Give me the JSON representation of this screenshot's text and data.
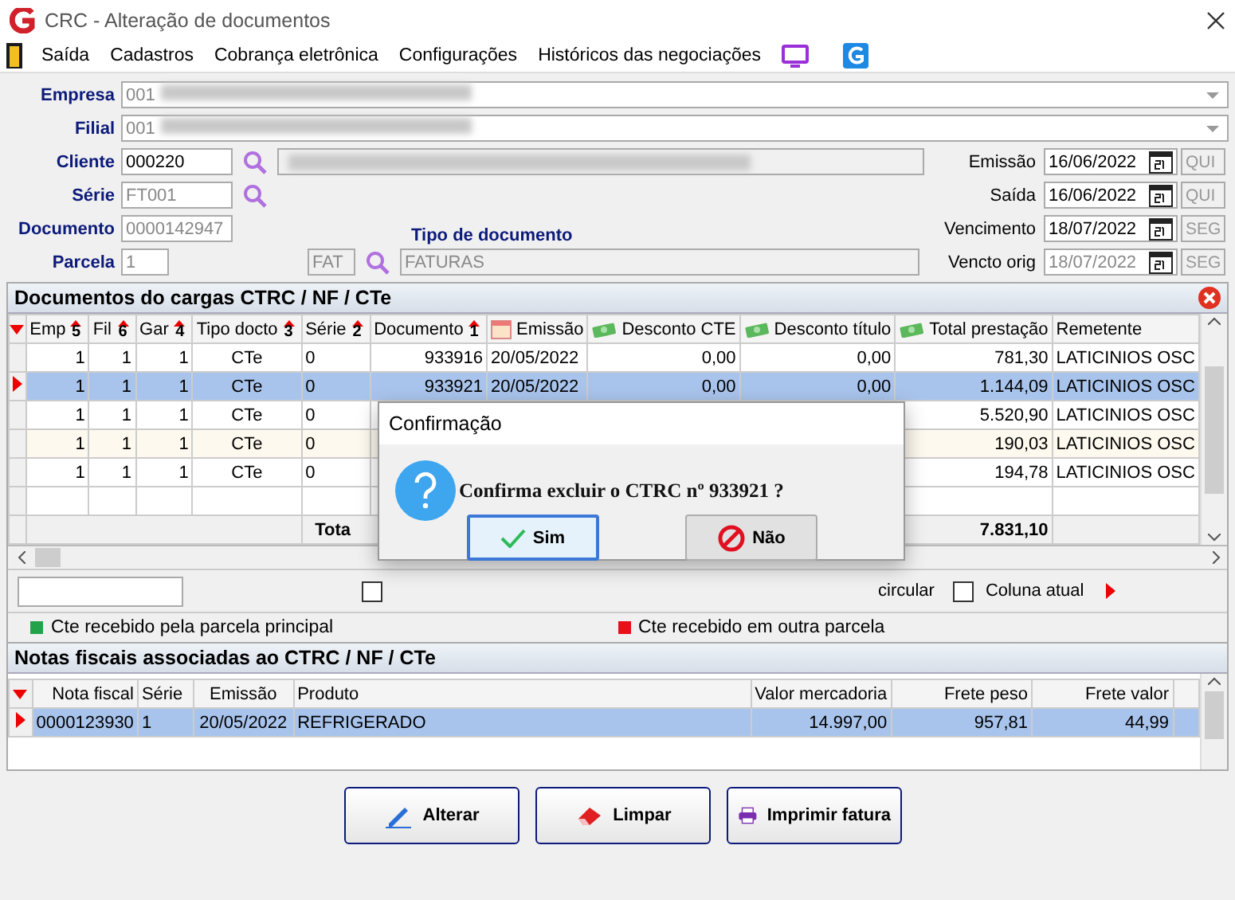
{
  "window": {
    "title": "CRC - Alteração de documentos"
  },
  "menu": [
    "Saída",
    "Cadastros",
    "Cobrança eletrônica",
    "Configurações",
    "Históricos das negociações"
  ],
  "form": {
    "empresa": {
      "label": "Empresa",
      "value": "001"
    },
    "filial": {
      "label": "Filial",
      "value": "001"
    },
    "cliente": {
      "label": "Cliente",
      "value": "000220"
    },
    "serie": {
      "label": "Série",
      "value": "FT001"
    },
    "documento": {
      "label": "Documento",
      "value": "0000142947"
    },
    "parcela": {
      "label": "Parcela",
      "value": "1"
    },
    "tipo_documento": {
      "label": "Tipo de documento",
      "code": "FAT",
      "name": "FATURAS"
    },
    "dates": [
      {
        "label": "Emissão",
        "value": "16/06/2022",
        "weekday": "QUI",
        "disabled": false
      },
      {
        "label": "Saída",
        "value": "16/06/2022",
        "weekday": "QUI",
        "disabled": false
      },
      {
        "label": "Vencimento",
        "value": "18/07/2022",
        "weekday": "SEG",
        "disabled": false
      },
      {
        "label": "Vencto orig",
        "value": "18/07/2022",
        "weekday": "SEG",
        "disabled": true
      }
    ]
  },
  "documents": {
    "title": "Documentos do cargas CTRC / NF / CTe",
    "columns": [
      {
        "label": "Emp",
        "sort": "5"
      },
      {
        "label": "Fil",
        "sort": "6"
      },
      {
        "label": "Gar",
        "sort": "4"
      },
      {
        "label": "Tipo docto",
        "sort": "3"
      },
      {
        "label": "Série",
        "sort": "2"
      },
      {
        "label": "Documento",
        "sort": "1"
      },
      {
        "label": "Emissão"
      },
      {
        "label": "Desconto CTE"
      },
      {
        "label": "Desconto título"
      },
      {
        "label": "Total prestação"
      },
      {
        "label": "Remetente"
      }
    ],
    "rows": [
      {
        "selected": false,
        "cells": [
          "1",
          "1",
          "1",
          "CTe",
          "0",
          "933916",
          "20/05/2022",
          "0,00",
          "0,00",
          "781,30",
          "LATICINIOS OSC"
        ]
      },
      {
        "selected": true,
        "cells": [
          "1",
          "1",
          "1",
          "CTe",
          "0",
          "933921",
          "20/05/2022",
          "0,00",
          "0,00",
          "1.144,09",
          "LATICINIOS OSC"
        ]
      },
      {
        "selected": false,
        "cells": [
          "1",
          "1",
          "1",
          "CTe",
          "0",
          null,
          null,
          null,
          null,
          "5.520,90",
          "LATICINIOS OSC"
        ]
      },
      {
        "selected": false,
        "cells": [
          "1",
          "1",
          "1",
          "CTe",
          "0",
          null,
          null,
          null,
          null,
          "190,03",
          "LATICINIOS OSC"
        ]
      },
      {
        "selected": false,
        "cells": [
          "1",
          "1",
          "1",
          "CTe",
          "0",
          null,
          null,
          null,
          null,
          "194,78",
          "LATICINIOS OSC"
        ]
      }
    ],
    "total_label": "Tota",
    "total_value": "7.831,10",
    "options": [
      {
        "label": "circular",
        "checked": false
      },
      {
        "label": "Coluna atual",
        "checked": false
      }
    ],
    "legend": [
      {
        "label": "Cte recebido pela parcela principal",
        "color": "#22a34a"
      },
      {
        "label": "Cte recebido em outra parcela",
        "color": "#e8101a"
      }
    ]
  },
  "notas": {
    "title": "Notas fiscais associadas ao CTRC / NF / CTe",
    "columns": [
      "Nota fiscal",
      "Série",
      "Emissão",
      "Produto",
      "Valor mercadoria",
      "Frete peso",
      "Frete valor"
    ],
    "rows": [
      {
        "selected": true,
        "cells": [
          "0000123930",
          "1",
          "20/05/2022",
          "REFRIGERADO",
          "14.997,00",
          "957,81",
          "44,99"
        ]
      }
    ]
  },
  "buttons": [
    {
      "label": "Alterar",
      "kind": "edit"
    },
    {
      "label": "Limpar",
      "kind": "erase"
    },
    {
      "label": "Imprimir fatura",
      "kind": "print"
    }
  ],
  "dialog": {
    "title": "Confirmação",
    "message": "Confirma excluir o CTRC nº 933921 ?",
    "buttons": [
      {
        "label": "Sim",
        "kind": "yes",
        "selected": true
      },
      {
        "label": "Não",
        "kind": "no",
        "selected": false
      }
    ]
  }
}
